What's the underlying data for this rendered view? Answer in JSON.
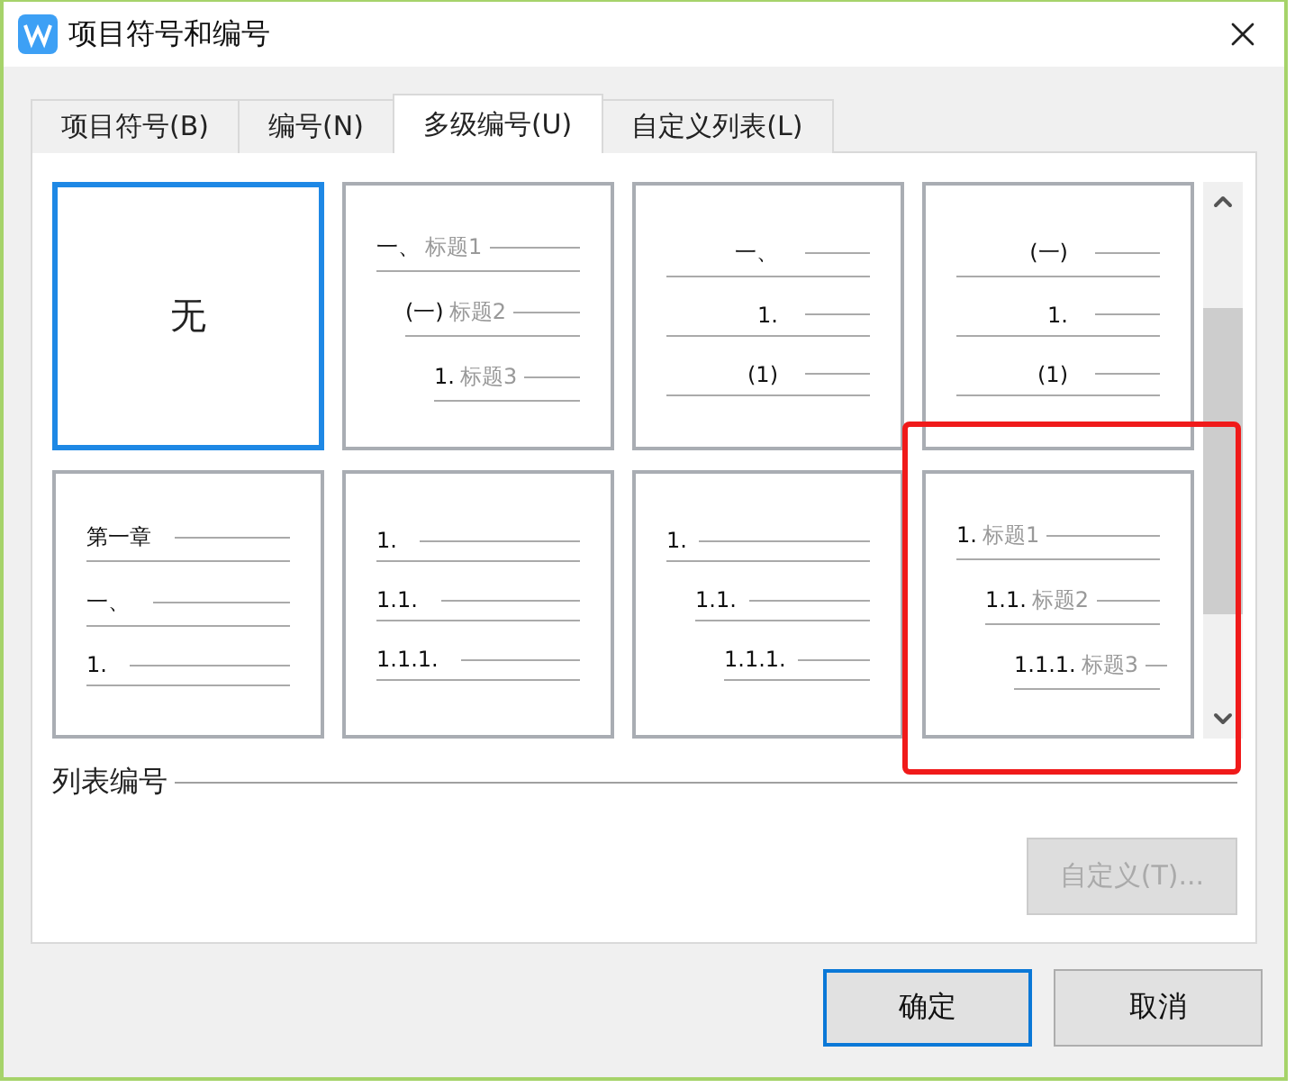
{
  "window": {
    "title": "项目符号和编号"
  },
  "tabs": [
    {
      "label": "项目符号(B)",
      "selected": false
    },
    {
      "label": "编号(N)",
      "selected": false
    },
    {
      "label": "多级编号(U)",
      "selected": true
    },
    {
      "label": "自定义列表(L)",
      "selected": false
    }
  ],
  "cards": [
    {
      "kind": "none",
      "label": "无",
      "selected": true,
      "highlighted": false
    },
    {
      "kind": "stepped",
      "selected": false,
      "highlighted": false,
      "lines": [
        {
          "number": "一、",
          "title": "标题1"
        },
        {
          "number": "(一)",
          "title": "标题2"
        },
        {
          "number": "1.",
          "title": "标题3"
        }
      ]
    },
    {
      "kind": "aligned",
      "selected": false,
      "highlighted": false,
      "lines": [
        {
          "number": "一、"
        },
        {
          "number": "1."
        },
        {
          "number": "(1)"
        }
      ]
    },
    {
      "kind": "aligned",
      "selected": false,
      "highlighted": false,
      "lines": [
        {
          "number": "(一)"
        },
        {
          "number": "1."
        },
        {
          "number": "(1)"
        }
      ]
    },
    {
      "kind": "flush",
      "selected": false,
      "highlighted": false,
      "lines": [
        {
          "number": "第一章"
        },
        {
          "number": "一、"
        },
        {
          "number": "1."
        }
      ]
    },
    {
      "kind": "flush",
      "selected": false,
      "highlighted": false,
      "lines": [
        {
          "number": "1."
        },
        {
          "number": "1.1."
        },
        {
          "number": "1.1.1."
        }
      ]
    },
    {
      "kind": "stepped",
      "selected": false,
      "highlighted": false,
      "lines": [
        {
          "number": "1."
        },
        {
          "number": "1.1."
        },
        {
          "number": "1.1.1."
        }
      ]
    },
    {
      "kind": "stepped",
      "selected": false,
      "highlighted": true,
      "lines": [
        {
          "number": "1.",
          "title": "标题1"
        },
        {
          "number": "1.1.",
          "title": "标题2"
        },
        {
          "number": "1.1.1.",
          "title": "标题3"
        }
      ]
    }
  ],
  "section": {
    "label": "列表编号"
  },
  "customize_button": {
    "label": "自定义(T)...",
    "disabled": true
  },
  "buttons": [
    {
      "label": "确定",
      "selected": true
    },
    {
      "label": "取消",
      "selected": false
    }
  ]
}
